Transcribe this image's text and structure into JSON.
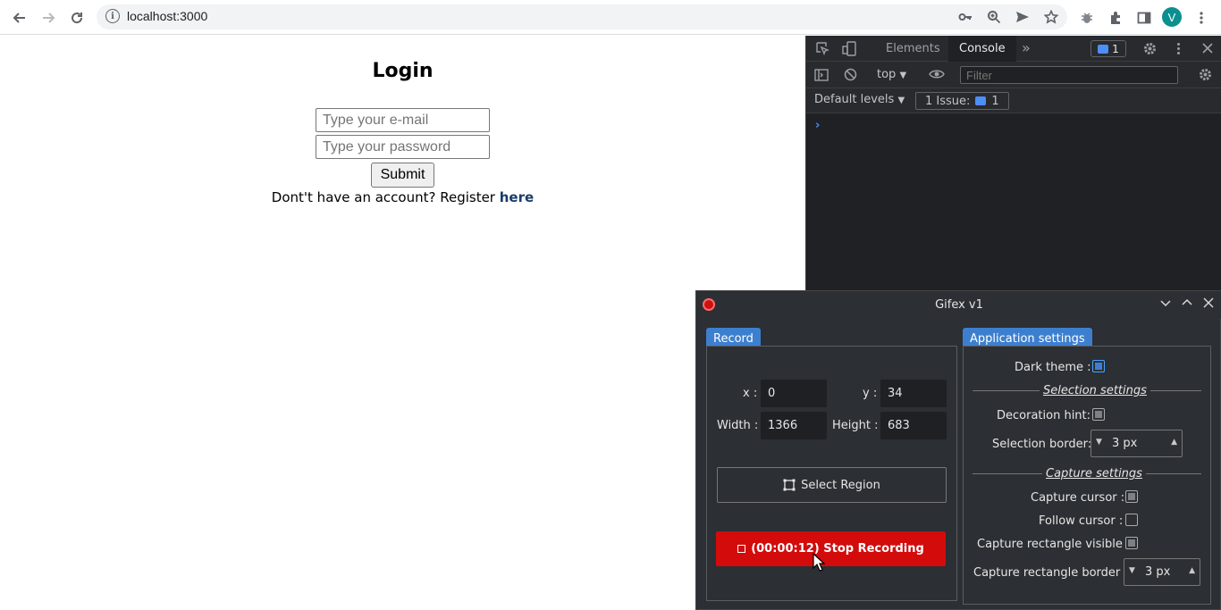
{
  "browser": {
    "url": "localhost:3000",
    "avatar_letter": "V",
    "icons": [
      "back-icon",
      "forward-icon",
      "reload-icon",
      "info-icon",
      "key-icon",
      "zoom-icon",
      "send-icon",
      "star-icon",
      "bug-icon",
      "extensions-icon",
      "sidebar-icon",
      "menu-icon"
    ]
  },
  "page": {
    "title": "Login",
    "email_placeholder": "Type your e-mail",
    "password_placeholder": "Type your password",
    "submit_label": "Submit",
    "register_text": "Dont't have an account? Register ",
    "register_link": "here"
  },
  "devtools": {
    "tabs": [
      "Elements",
      "Console"
    ],
    "active_tab": "Console",
    "issues_badge": "1",
    "context": "top",
    "filter_placeholder": "Filter",
    "levels": "Default levels",
    "issue_label": "1 Issue:",
    "issue_count": "1",
    "prompt": "›"
  },
  "gifex": {
    "title": "Gifex v1",
    "record_tab": "Record",
    "settings_tab": "Application settings",
    "x_label": "x :",
    "x_value": "0",
    "y_label": "y :",
    "y_value": "34",
    "width_label": "Width :",
    "width_value": "1366",
    "height_label": "Height :",
    "height_value": "683",
    "select_region": "Select Region",
    "stop_recording": "(00:00:12) Stop Recording",
    "dark_theme_label": "Dark theme :",
    "dark_theme": true,
    "selection_settings": "Selection settings",
    "decoration_hint_label": "Decoration hint:",
    "decoration_hint": true,
    "selection_border_label": "Selection border:",
    "selection_border_value": "3 px",
    "capture_settings": "Capture settings",
    "capture_cursor_label": "Capture cursor :",
    "capture_cursor": true,
    "follow_cursor_label": "Follow cursor :",
    "follow_cursor": false,
    "capture_rect_visible_label": "Capture rectangle visible :",
    "capture_rect_visible": true,
    "capture_rect_border_label": "Capture rectangle border :",
    "capture_rect_border_value": "3 px"
  },
  "colors": {
    "record_red": "#d40b0b",
    "tab_blue": "#3d7fcf",
    "devtools_bg": "#202124",
    "gifex_bg": "#2c2f33"
  }
}
